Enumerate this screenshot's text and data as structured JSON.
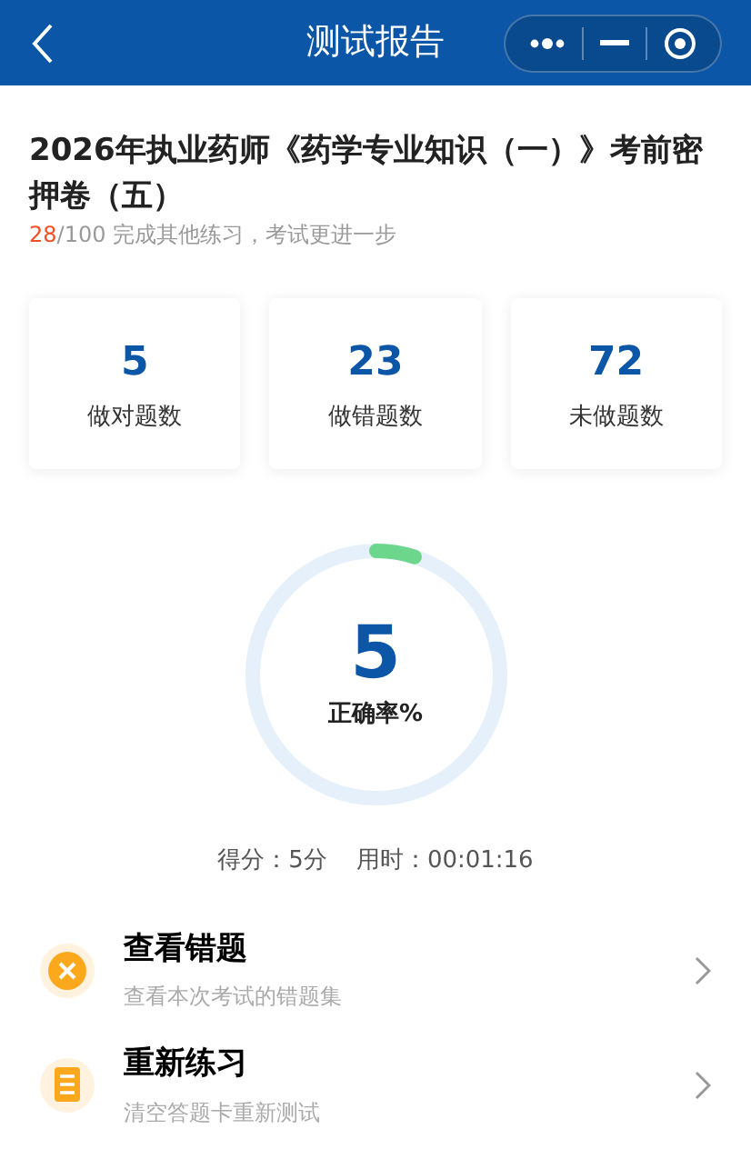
{
  "header": {
    "title": "测试报告"
  },
  "exam": {
    "title": "2026年执业药师《药学专业知识（一）》考前密押卷（五）",
    "done": "28",
    "progress_rest": "/100 完成其他练习，考试更进一步"
  },
  "stats": [
    {
      "value": "5",
      "label": "做对题数"
    },
    {
      "value": "23",
      "label": "做错题数"
    },
    {
      "value": "72",
      "label": "未做题数"
    }
  ],
  "accuracy": {
    "value": "5",
    "label": "正确率%",
    "level": 0.05
  },
  "summary": [
    "得分：5分",
    "用时：00:01:16"
  ],
  "actions": [
    {
      "kind": "wrong",
      "title": "查看错题",
      "subtitle": "查看本次考试的错题集"
    },
    {
      "kind": "retry",
      "title": "重新练习",
      "subtitle": "清空答题卡重新测试"
    }
  ]
}
